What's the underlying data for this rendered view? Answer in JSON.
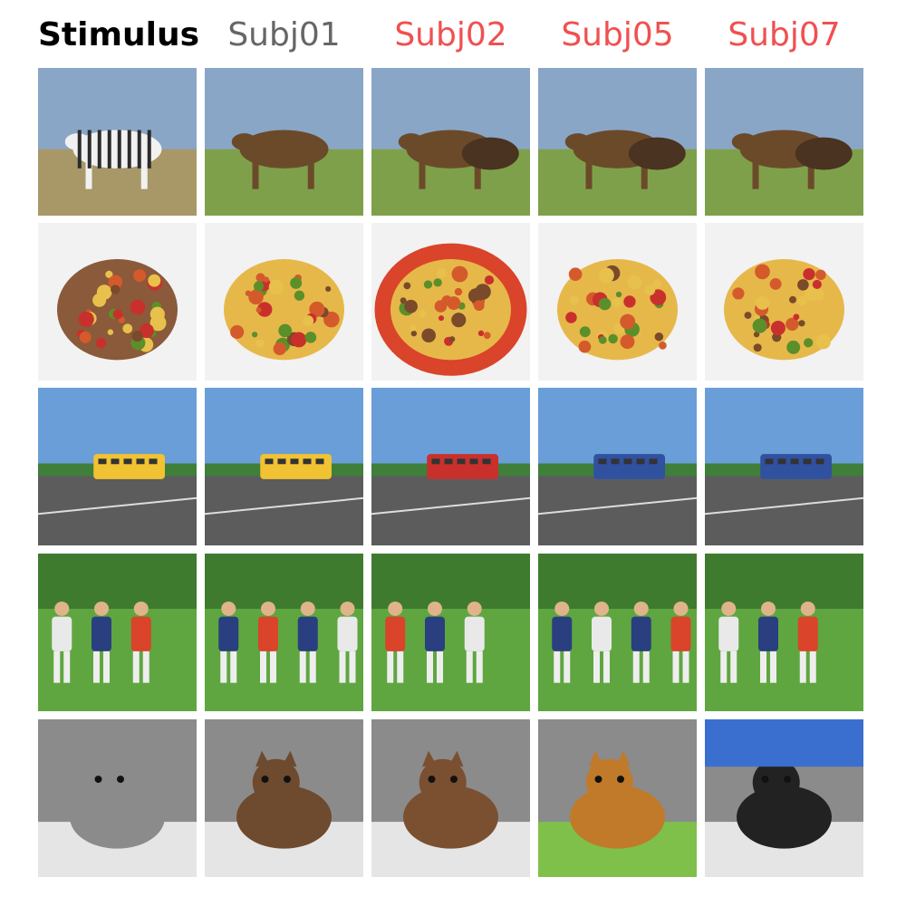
{
  "columns": [
    {
      "label": "Stimulus",
      "color": "#000000"
    },
    {
      "label": "Subj01",
      "color": "#666666"
    },
    {
      "label": "Subj02",
      "color": "#f05050"
    },
    {
      "label": "Subj05",
      "color": "#f05050"
    },
    {
      "label": "Subj07",
      "color": "#f05050"
    }
  ],
  "rows": [
    {
      "theme": "zebra-horses",
      "palette": [
        "#8aa6c7",
        "#b99c6a",
        "#f1f1f1",
        "#2b2b2b",
        "#6e8a3c"
      ]
    },
    {
      "theme": "food-plate",
      "palette": [
        "#f2f2f2",
        "#d45a2c",
        "#5b8f2a",
        "#e7c14b",
        "#c9302c"
      ]
    },
    {
      "theme": "train-station",
      "palette": [
        "#6a9ed8",
        "#f1c232",
        "#5c5c5c",
        "#3f7f3a",
        "#9a9a9a"
      ]
    },
    {
      "theme": "baseball-sports",
      "palette": [
        "#3f7b2e",
        "#5fa640",
        "#e9e9e9",
        "#2a3f7f",
        "#d9b14a"
      ]
    },
    {
      "theme": "cat-animals",
      "palette": [
        "#8b8b8b",
        "#6e4a2e",
        "#e5e5e5",
        "#2c2c2c",
        "#3b6fcf"
      ]
    }
  ]
}
